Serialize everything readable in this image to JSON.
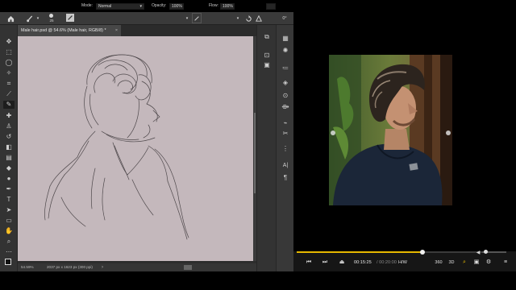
{
  "colors": {
    "canvas": "#c4b8bc",
    "accent": "#e6b800",
    "ps_panel": "#333333"
  },
  "optionbar": {
    "mode_label": "Mode:",
    "mode_value": "Normal",
    "opacity_label": "Opacity:",
    "opacity_value": "100%",
    "flow_label": "Flow:",
    "flow_value": "100%",
    "angle_value": "0°",
    "brush_size": "25"
  },
  "document": {
    "tab_title": "Male hair.psd @ 54.6% (Male hair, RGB/8) *",
    "close_glyph": "×"
  },
  "statusbar": {
    "zoom": "54.59%",
    "doc_info": "2037 px x 1623 px (300 ppi)"
  },
  "player": {
    "current_time": "00:15:25",
    "total_time": "/ 00:20:00",
    "aspect_label": "H/W",
    "seek_progress": 0.61,
    "volume_level": 0.05,
    "icons": [
      "prev-icon",
      "next-icon",
      "eject-icon",
      "360-icon",
      "3d-icon",
      "search-icon",
      "subtitle-icon",
      "settings-icon",
      "menu-icon"
    ]
  }
}
